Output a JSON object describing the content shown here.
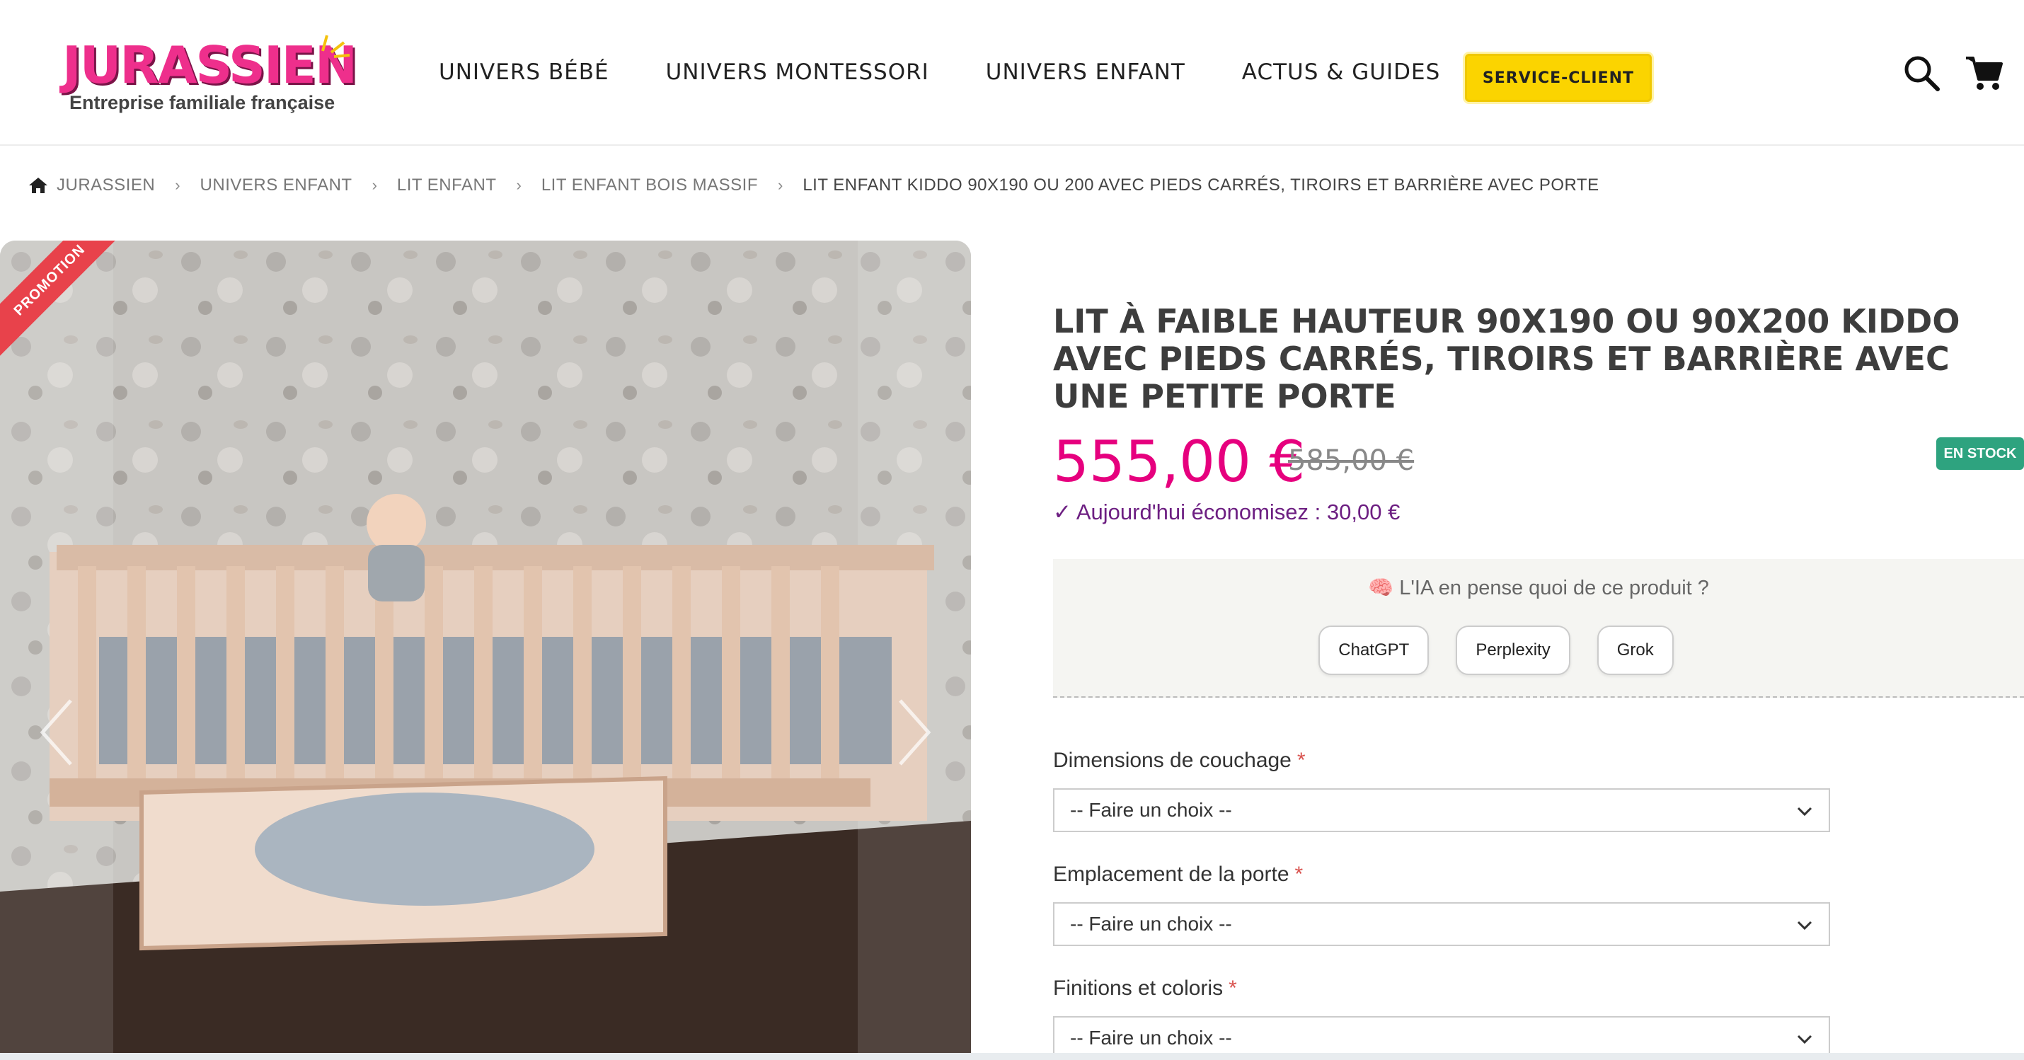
{
  "header": {
    "logo_text": "JURASSIEN",
    "logo_sub": "Entreprise familiale française",
    "nav": [
      "UNIVERS BÉBÉ",
      "UNIVERS MONTESSORI",
      "UNIVERS ENFANT",
      "ACTUS & GUIDES"
    ],
    "service_label": "SERVICE-CLIENT",
    "icons": [
      "search-icon",
      "cart-icon"
    ]
  },
  "breadcrumb": {
    "home": "JURASSIEN",
    "items": [
      "UNIVERS ENFANT",
      "LIT ENFANT",
      "LIT ENFANT BOIS MASSIF"
    ],
    "current": "LIT ENFANT KIDDO 90X190 OU 200 AVEC PIEDS CARRÉS, TIROIRS ET BARRIÈRE AVEC PORTE"
  },
  "product": {
    "promo_label": "PROMOTION",
    "title": "LIT À FAIBLE HAUTEUR 90X190 OU 90X200 KIDDO AVEC PIEDS CARRÉS, TIROIRS ET BARRIÈRE AVEC UNE PETITE PORTE",
    "price": "555,00 €",
    "old_price": "585,00 €",
    "stock": "EN STOCK",
    "saving": "✓ Aujourd'hui économisez : 30,00 €"
  },
  "ai": {
    "question": "🧠 L'IA en pense quoi de ce produit ?",
    "buttons": [
      "ChatGPT",
      "Perplexity",
      "Grok"
    ]
  },
  "options": [
    {
      "label": "Dimensions de couchage",
      "value": "-- Faire un choix --"
    },
    {
      "label": "Emplacement de la porte",
      "value": "-- Faire un choix --"
    },
    {
      "label": "Finitions et coloris",
      "value": "-- Faire un choix --"
    }
  ],
  "colors": {
    "brand_pink": "#e6007e",
    "service_yellow": "#fbd400",
    "stock_green": "#2ea37f",
    "saving_purple": "#6d1f82",
    "promo_red": "#e8424b"
  }
}
